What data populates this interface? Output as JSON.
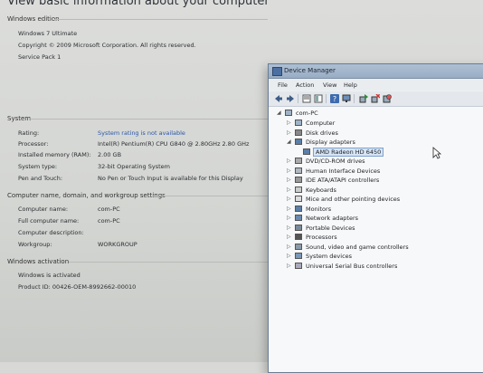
{
  "system": {
    "heading": "View basic information about your computer",
    "windows_edition": {
      "title": "Windows edition",
      "edition": "Windows 7 Ultimate",
      "copyright": "Copyright © 2009 Microsoft Corporation.  All rights reserved.",
      "service_pack": "Service Pack 1"
    },
    "system_section": {
      "title": "System",
      "rows": [
        {
          "label": "Rating:",
          "value": "System rating is not available"
        },
        {
          "label": "Processor:",
          "value": "Intel(R) Pentium(R) CPU G840 @ 2.80GHz   2.80 GHz"
        },
        {
          "label": "Installed memory (RAM):",
          "value": "2.00 GB"
        },
        {
          "label": "System type:",
          "value": "32-bit Operating System"
        },
        {
          "label": "Pen and Touch:",
          "value": "No Pen or Touch Input is available for this Display"
        }
      ]
    },
    "computer_name_section": {
      "title": "Computer name, domain, and workgroup settings",
      "rows": [
        {
          "label": "Computer name:",
          "value": "com-PC"
        },
        {
          "label": "Full computer name:",
          "value": "com-PC"
        },
        {
          "label": "Computer description:",
          "value": ""
        },
        {
          "label": "Workgroup:",
          "value": "WORKGROUP"
        }
      ]
    },
    "activation_section": {
      "title": "Windows activation",
      "status": "Windows is activated",
      "product_id": "Product ID: 00426-OEM-8992662-00010"
    }
  },
  "device_manager": {
    "title": "Device Manager",
    "menu": [
      "File",
      "Action",
      "View",
      "Help"
    ],
    "toolbar_icons": [
      "back-icon",
      "forward-icon",
      "properties-icon",
      "view-icon",
      "help-icon",
      "monitor-icon",
      "update-driver-icon",
      "uninstall-icon",
      "scan-icon"
    ],
    "root": "com-PC",
    "categories": [
      {
        "label": "Computer",
        "expanded": false
      },
      {
        "label": "Disk drives",
        "expanded": false
      },
      {
        "label": "Display adapters",
        "expanded": true
      },
      {
        "label": "AMD Radeon HD 6450",
        "child": true,
        "selected": true
      },
      {
        "label": "DVD/CD-ROM drives",
        "expanded": false
      },
      {
        "label": "Human Interface Devices",
        "expanded": false
      },
      {
        "label": "IDE ATA/ATAPI controllers",
        "expanded": false
      },
      {
        "label": "Keyboards",
        "expanded": false
      },
      {
        "label": "Mice and other pointing devices",
        "expanded": false
      },
      {
        "label": "Monitors",
        "expanded": false
      },
      {
        "label": "Network adapters",
        "expanded": false
      },
      {
        "label": "Portable Devices",
        "expanded": false
      },
      {
        "label": "Processors",
        "expanded": false
      },
      {
        "label": "Sound, video and game controllers",
        "expanded": false
      },
      {
        "label": "System devices",
        "expanded": false
      },
      {
        "label": "Universal Serial Bus controllers",
        "expanded": false
      }
    ]
  }
}
